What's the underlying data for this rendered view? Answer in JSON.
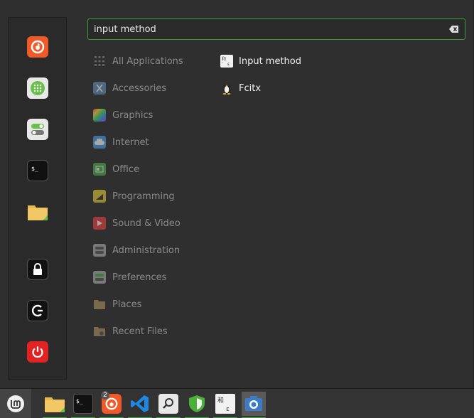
{
  "search": {
    "value": "input method",
    "placeholder": ""
  },
  "favorites": [
    {
      "name": "firefox",
      "icon": "firefox-icon"
    },
    {
      "name": "software-manager",
      "icon": "software-manager-icon"
    },
    {
      "name": "system-settings",
      "icon": "settings-toggle-icon"
    },
    {
      "name": "terminal",
      "icon": "terminal-icon"
    },
    {
      "name": "files",
      "icon": "folder-icon"
    },
    {
      "name": "lock-screen",
      "icon": "lock-icon"
    },
    {
      "name": "logout",
      "icon": "logout-icon"
    },
    {
      "name": "shutdown",
      "icon": "power-icon"
    }
  ],
  "categories": [
    {
      "label": "All Applications"
    },
    {
      "label": "Accessories"
    },
    {
      "label": "Graphics"
    },
    {
      "label": "Internet"
    },
    {
      "label": "Office"
    },
    {
      "label": "Programming"
    },
    {
      "label": "Sound & Video"
    },
    {
      "label": "Administration"
    },
    {
      "label": "Preferences"
    },
    {
      "label": "Places"
    },
    {
      "label": "Recent Files"
    }
  ],
  "results": [
    {
      "label": "Input method",
      "icon": "input-method-icon"
    },
    {
      "label": "Fcitx",
      "icon": "penguin-icon"
    }
  ],
  "taskbar": {
    "firefox_badge": "2"
  },
  "colors": {
    "accent": "#3c9b3c",
    "firefox": "#f05a28",
    "power": "#e02424"
  }
}
